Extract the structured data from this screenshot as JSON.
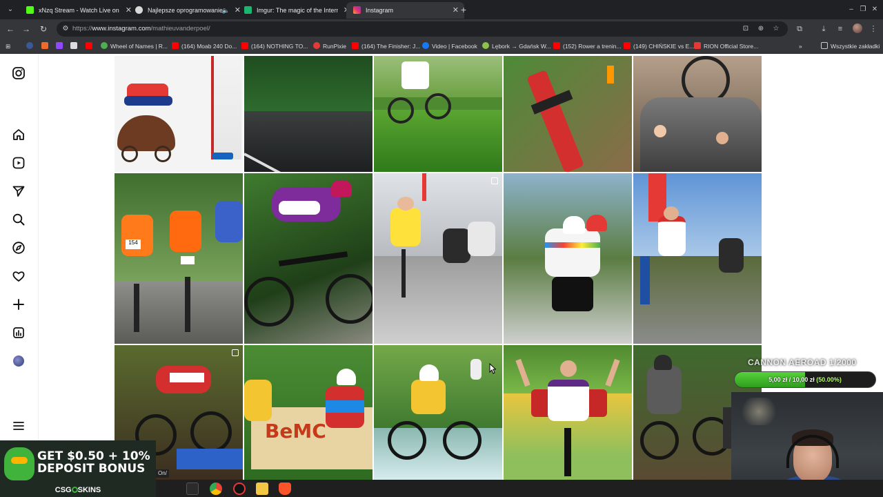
{
  "browser": {
    "tabs": [
      {
        "title": "xNzq Stream - Watch Live on K",
        "favicon_color": "#53fc18",
        "active": false
      },
      {
        "title": "Najlepsze oprogramowanie",
        "favicon_color": "#d8d8d8",
        "active": false
      },
      {
        "title": "Imgur: The magic of the Intern",
        "favicon_color": "#1bb76e",
        "active": false
      },
      {
        "title": "Instagram",
        "favicon_color": "#e1306c",
        "active": true
      }
    ],
    "new_tab_label": "+",
    "window_controls": [
      "–",
      "❐",
      "✕"
    ],
    "url_prefix": "https://",
    "url_host": "www.instagram.com",
    "url_path": "/mathieuvanderpoel/",
    "bookmarks": [
      {
        "label": "",
        "color": "#3b5998"
      },
      {
        "label": "",
        "color": "#f06b2b"
      },
      {
        "label": "",
        "color": "#9146ff"
      },
      {
        "label": "",
        "color": "#ffffff"
      },
      {
        "label": "",
        "color": "#ff0000"
      },
      {
        "label": "Wheel of Names | R...",
        "color": "#4caf50"
      },
      {
        "label": "(164) Moab 240 Do...",
        "color": "#ff0000"
      },
      {
        "label": "(164) NOTHING TO...",
        "color": "#ff0000"
      },
      {
        "label": "RunPixie",
        "color": "#e53935"
      },
      {
        "label": "(164) The Finisher: J...",
        "color": "#ff0000"
      },
      {
        "label": "Video | Facebook",
        "color": "#1877f2"
      },
      {
        "label": "Lębork → Gdańsk W...",
        "color": "#8bc34a"
      },
      {
        "label": "(152) Rower a trenin...",
        "color": "#ff0000"
      },
      {
        "label": "(149) CHIŃSKIE vs E...",
        "color": "#ff0000"
      },
      {
        "label": "RION Official Store...",
        "color": "#e53935"
      }
    ],
    "all_bookmarks_label": "Wszystkie zakładki"
  },
  "instagram": {
    "sidebar_icons": [
      "instagram-logo-icon",
      "home-icon",
      "reels-icon",
      "messages-icon",
      "search-icon",
      "explore-icon",
      "notifications-icon",
      "create-icon",
      "dashboard-icon",
      "profile-avatar",
      "menu-icon"
    ]
  },
  "ad": {
    "headline": "GET $0.50 + 10% DEPOSIT BONUS",
    "brand_left": "CSG",
    "brand_right": "SKINS"
  },
  "goal": {
    "title": "CANNON AEROAD 1/2000",
    "current": "5,00 zł",
    "separator": "/",
    "target": "10,00 zł",
    "percent_label": "(50.00%)",
    "progress": 0.5
  },
  "taskbar": {
    "partial_label": "On/"
  },
  "colors": {
    "chrome_dark": "#202124",
    "chrome_toolbar": "#35363a",
    "goal_green": "#3fb626"
  }
}
